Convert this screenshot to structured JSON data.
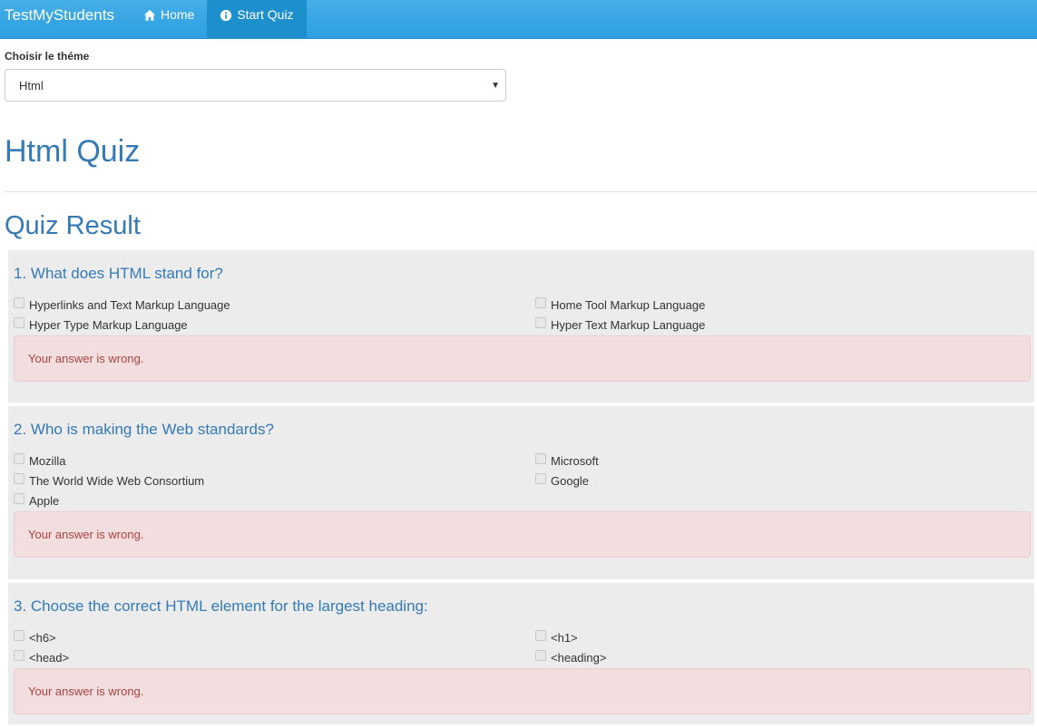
{
  "navbar": {
    "brand": "TestMyStudents",
    "items": [
      {
        "label": "Home",
        "icon": "home-icon"
      },
      {
        "label": "Start Quiz",
        "icon": "info-icon"
      }
    ]
  },
  "theme_select": {
    "label": "Choisir le théme",
    "value": "Html"
  },
  "quiz_title": "Html Quiz",
  "result_title": "Quiz Result",
  "questions": [
    {
      "title": "1. What does HTML stand for?",
      "options": [
        "Hyperlinks and Text Markup Language",
        "Home Tool Markup Language",
        "Hyper Type Markup Language",
        "Hyper Text Markup Language"
      ],
      "alert": "Your answer is wrong."
    },
    {
      "title": "2. Who is making the Web standards?",
      "options": [
        "Mozilla",
        "Microsoft",
        "The World Wide Web Consortium",
        "Google",
        "Apple"
      ],
      "alert": "Your answer is wrong."
    },
    {
      "title": "3. Choose the correct HTML element for the largest heading:",
      "options": [
        "<h6>",
        "<h1>",
        "<head>",
        "<heading>"
      ],
      "alert": "Your answer is wrong."
    }
  ]
}
